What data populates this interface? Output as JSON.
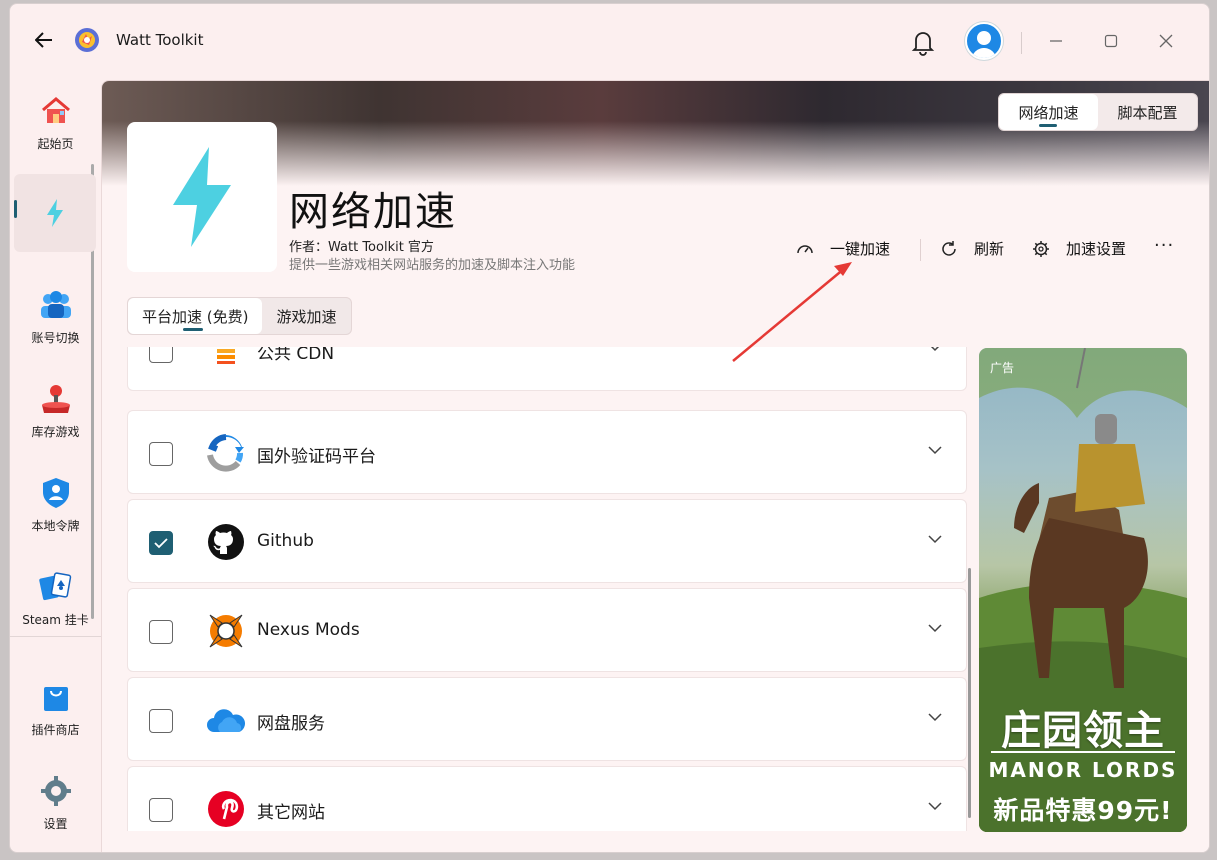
{
  "app": {
    "title": "Watt Toolkit"
  },
  "sidebar": {
    "items": [
      {
        "label": "起始页",
        "icon": "home-icon"
      },
      {
        "label": "",
        "icon": "lightning-icon"
      },
      {
        "label": "账号切换",
        "icon": "users-icon"
      },
      {
        "label": "库存游戏",
        "icon": "joystick-icon"
      },
      {
        "label": "本地令牌",
        "icon": "shield-icon"
      },
      {
        "label": "Steam 挂卡",
        "icon": "cards-icon"
      },
      {
        "label": "插件商店",
        "icon": "shopping-bag-icon"
      },
      {
        "label": "设置",
        "icon": "gear-icon"
      }
    ]
  },
  "header": {
    "tabs": [
      "网络加速",
      "脚本配置"
    ]
  },
  "plugin": {
    "title": "网络加速",
    "author": "作者：Watt Toolkit  官方",
    "description": "提供一些游戏相关网站服务的加速及脚本注入功能"
  },
  "actions": {
    "accelerate": "一键加速",
    "refresh": "刷新",
    "settings": "加速设置",
    "more": "···"
  },
  "subtabs": [
    "平台加速 (免费)",
    "游戏加速"
  ],
  "services": [
    {
      "name": "公共 CDN",
      "checked": false,
      "icon": "cdn-icon"
    },
    {
      "name": "国外验证码平台",
      "checked": false,
      "icon": "recaptcha-icon"
    },
    {
      "name": "Github",
      "checked": true,
      "icon": "github-icon"
    },
    {
      "name": "Nexus Mods",
      "checked": false,
      "icon": "nexus-mods-icon"
    },
    {
      "name": "网盘服务",
      "checked": false,
      "icon": "cloud-icon"
    },
    {
      "name": "其它网站",
      "checked": false,
      "icon": "pinterest-icon"
    }
  ],
  "ad": {
    "tag": "广告",
    "title": "庄园领主",
    "subtitle": "MANOR LORDS",
    "promo": "新品特惠99元!"
  },
  "colors": {
    "accent": "#1f5f73",
    "lightning": "#4dd0e1",
    "annotation": "#e53935"
  }
}
